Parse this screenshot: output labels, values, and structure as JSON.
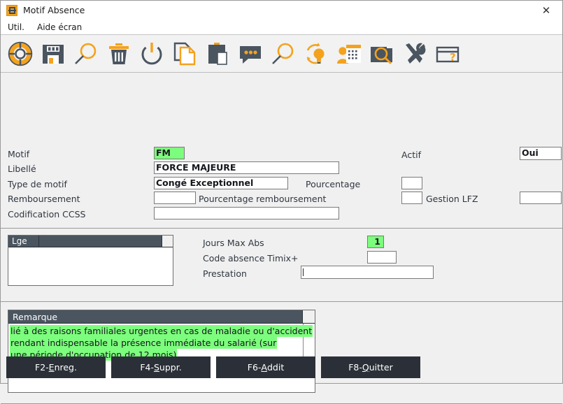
{
  "window": {
    "title": "Motif Absence",
    "app_icon": "window-app-icon",
    "close_label": "✕"
  },
  "menubar": {
    "items": [
      {
        "label": "Util."
      },
      {
        "label": "Aide écran"
      }
    ]
  },
  "toolbar": {
    "buttons": [
      {
        "name": "lifebuoy-icon",
        "title": "Aide"
      },
      {
        "name": "save-icon",
        "title": "Enregistrer"
      },
      {
        "name": "search-icon",
        "title": "Rechercher"
      },
      {
        "name": "trash-icon",
        "title": "Supprimer"
      },
      {
        "name": "power-icon",
        "title": "Quitter"
      },
      {
        "name": "copy-icon",
        "title": "Copier"
      },
      {
        "name": "paste-icon",
        "title": "Coller"
      },
      {
        "name": "comment-icon",
        "title": "Commentaire"
      },
      {
        "name": "magnifier-icon",
        "title": "Zoom"
      },
      {
        "name": "refresh-idea-icon",
        "title": "Actualiser"
      },
      {
        "name": "user-calendar-icon",
        "title": "Planning"
      },
      {
        "name": "photo-search-icon",
        "title": "Consulter"
      },
      {
        "name": "tools-icon",
        "title": "Outils"
      },
      {
        "name": "help-window-icon",
        "title": "Aide fenêtre"
      }
    ]
  },
  "form": {
    "motif": {
      "label": "Motif",
      "value": "FM"
    },
    "libelle": {
      "label": "Libellé",
      "value": "FORCE MAJEURE"
    },
    "type_motif": {
      "label": "Type de motif",
      "value": "Congé Exceptionnel"
    },
    "pourcentage": {
      "label": "Pourcentage",
      "value": ""
    },
    "remboursement": {
      "label": "Remboursement",
      "value": ""
    },
    "pourcentage_remboursement": {
      "label": "Pourcentage remboursement",
      "value": ""
    },
    "gestion_lfz": {
      "label": "Gestion LFZ",
      "value": ""
    },
    "gestion_lfz_extra": {
      "value": ""
    },
    "codification_ccss": {
      "label": "Codification CCSS",
      "value": ""
    },
    "actif": {
      "label": "Actif",
      "value": "Oui"
    }
  },
  "lge_list": {
    "columns": [
      "Lge",
      ""
    ],
    "rows": []
  },
  "middle": {
    "jours_max_abs": {
      "label": "Jours Max Abs",
      "value": "1"
    },
    "code_absence_timix": {
      "label": "Code absence Timix+",
      "value": ""
    },
    "prestation": {
      "label": "Prestation",
      "value": ""
    }
  },
  "remarque": {
    "header": "Remarque",
    "lines": [
      "lié à des raisons familiales urgentes en cas de maladie ou d'accident",
      "rendant indispensable la présence immédiate du salarié (sur",
      "une période d'occupation de 12 mois)"
    ]
  },
  "footer": {
    "buttons": [
      {
        "pre": "F2-",
        "key": "E",
        "post": "nreg."
      },
      {
        "pre": "F4-",
        "key": "S",
        "post": "uppr."
      },
      {
        "pre": "F6-",
        "key": "A",
        "post": "ddit"
      },
      {
        "pre": "F8-",
        "key": "Q",
        "post": "uitter"
      }
    ]
  },
  "colors": {
    "highlight_green": "#7dfd7d",
    "header_dark": "#4a5560",
    "button_dark": "#2b3038",
    "accent_orange": "#f4a21e",
    "icon_slate": "#4a5560"
  }
}
